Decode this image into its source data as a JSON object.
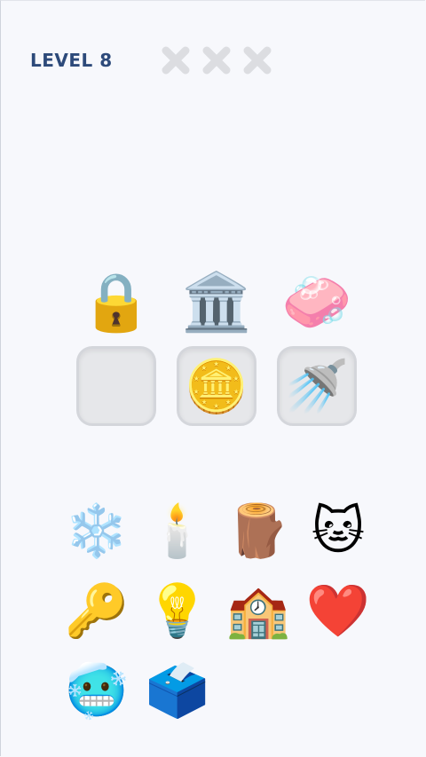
{
  "header": {
    "level_label": "LEVEL 8"
  },
  "lives": [
    {
      "icon": "x-mark-icon"
    },
    {
      "icon": "x-mark-icon"
    },
    {
      "icon": "x-mark-icon"
    }
  ],
  "clues": [
    {
      "emoji": "🔒",
      "icon": "padlock-icon"
    },
    {
      "emoji": "🏛️",
      "icon": "bank-icon"
    },
    {
      "emoji": "🧼",
      "icon": "soap-icon"
    }
  ],
  "slots": [
    {
      "emoji": "",
      "icon": "empty-slot"
    },
    {
      "emoji": "🪙",
      "icon": "coin-icon"
    },
    {
      "emoji": "🚿",
      "icon": "shower-icon"
    }
  ],
  "choices": [
    {
      "emoji": "❄️",
      "icon": "snowflake-icon"
    },
    {
      "emoji": "🕯️",
      "icon": "candle-icon"
    },
    {
      "emoji": "🪵",
      "icon": "wood-log-icon"
    },
    {
      "emoji": "🐱",
      "icon": "cat-face-icon"
    },
    {
      "emoji": "🔑",
      "icon": "key-icon"
    },
    {
      "emoji": "💡",
      "icon": "light-bulb-icon"
    },
    {
      "emoji": "🏫",
      "icon": "school-icon"
    },
    {
      "emoji": "❤️",
      "icon": "red-heart-icon"
    },
    {
      "emoji": "🥶",
      "icon": "cold-face-icon"
    },
    {
      "emoji": "🗳️",
      "icon": "ballot-box-icon"
    }
  ]
}
